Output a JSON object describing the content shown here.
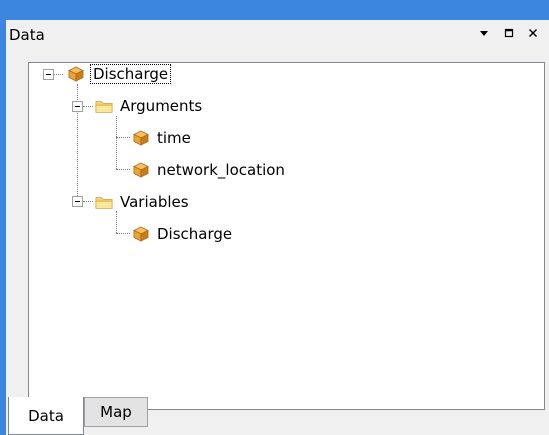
{
  "panel": {
    "title": "Data"
  },
  "tree": {
    "root": {
      "label": "Discharge",
      "icon": "cube-icon",
      "expanded": true,
      "selected": true
    },
    "arguments": {
      "label": "Arguments",
      "icon": "folder-icon",
      "expanded": true
    },
    "arg_time": {
      "label": "time",
      "icon": "cube-icon"
    },
    "arg_network_location": {
      "label": "network_location",
      "icon": "cube-icon"
    },
    "variables": {
      "label": "Variables",
      "icon": "folder-icon",
      "expanded": true
    },
    "var_discharge": {
      "label": "Discharge",
      "icon": "cube-icon"
    }
  },
  "tabs": [
    {
      "label": "Data",
      "active": true
    },
    {
      "label": "Map",
      "active": false
    }
  ],
  "colors": {
    "accent": "#3d86e0",
    "cube": "#e8a33a",
    "folder": "#f5d66f"
  }
}
